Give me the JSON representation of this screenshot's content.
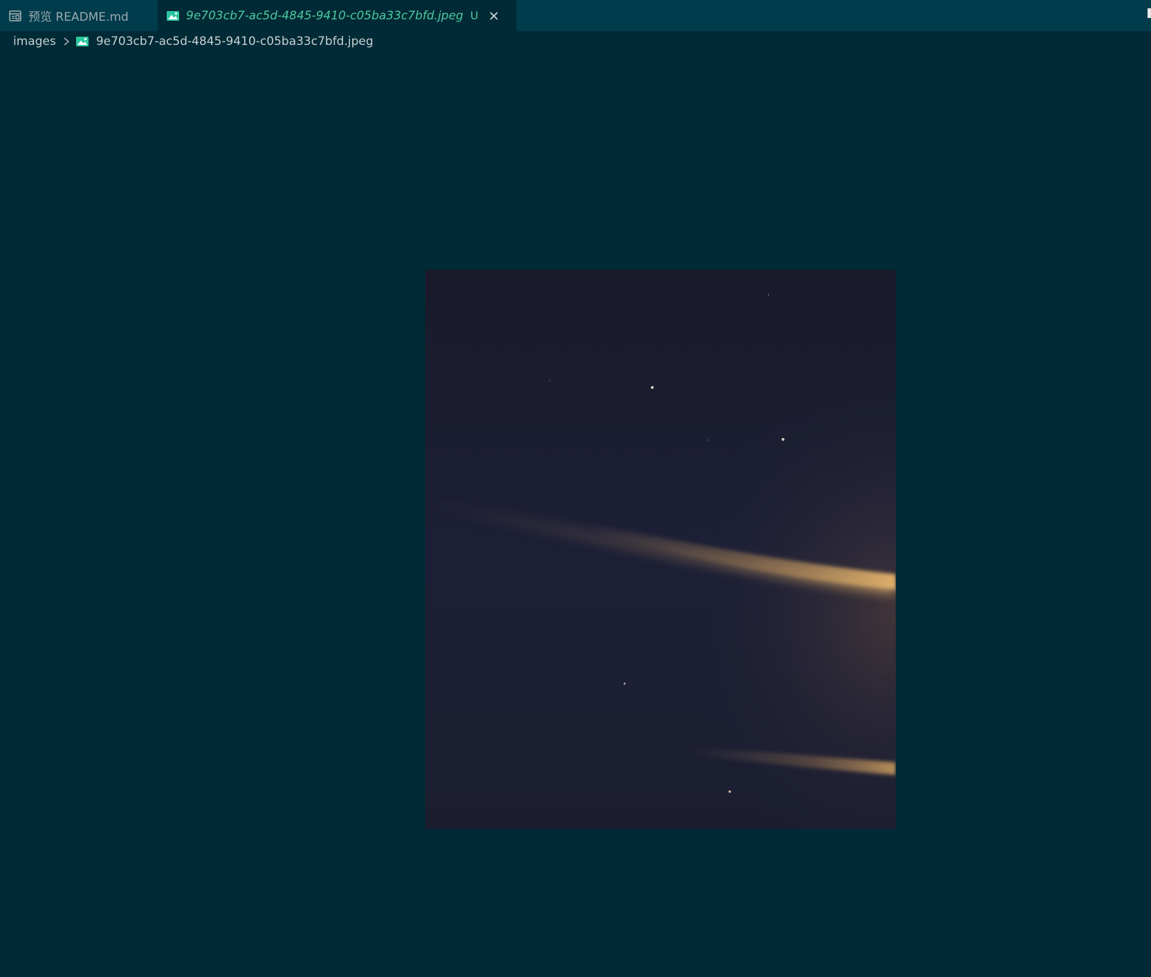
{
  "tabs": [
    {
      "label": "预览 README.md",
      "icon": "preview-icon",
      "active": false
    },
    {
      "label": "9e703cb7-ac5d-4845-9410-c05ba33c7bfd.jpeg",
      "icon": "image-file-icon",
      "active": true,
      "badge": "U",
      "close_icon": "close-icon"
    }
  ],
  "breadcrumb": {
    "folder": "images",
    "separator_icon": "chevron-right-icon",
    "file_icon": "image-file-icon",
    "file": "9e703cb7-ac5d-4845-9410-c05ba33c7bfd.jpeg"
  },
  "colors": {
    "editor_background": "#002a36",
    "tabbar_background": "#003c4c",
    "active_tab_text": "#4cc9a0",
    "inactive_tab_text": "#9aa9ae",
    "breadcrumb_text": "#c7d0d3",
    "image_file_icon": "#2bc7a0"
  },
  "preview": {
    "image_description_icon": "night-sky-photo"
  }
}
